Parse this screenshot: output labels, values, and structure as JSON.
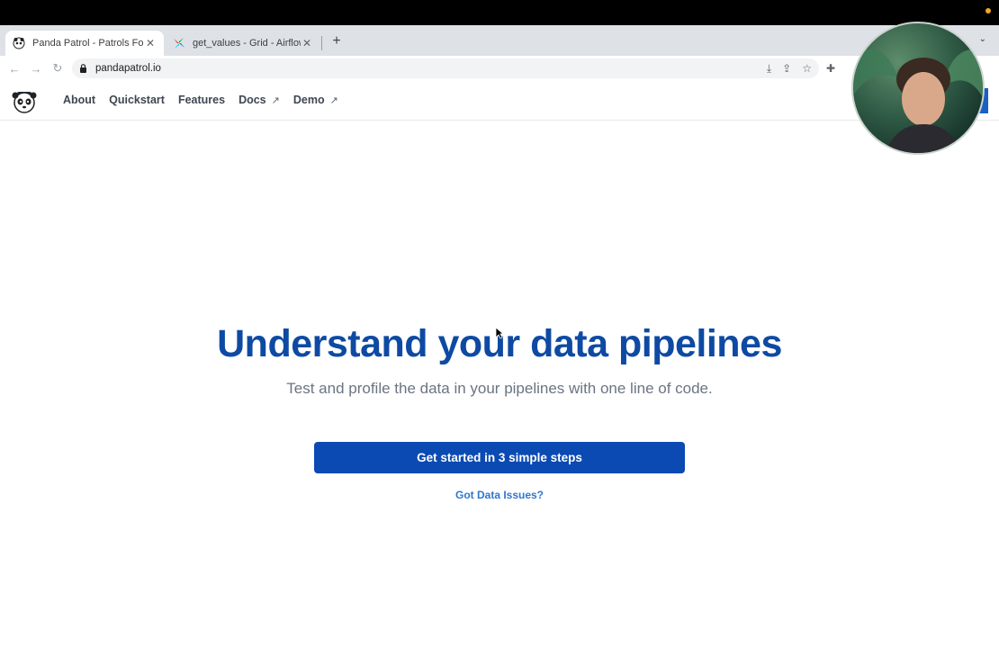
{
  "browser": {
    "tabs": [
      {
        "title": "Panda Patrol - Patrols For Dat",
        "active": true
      },
      {
        "title": "get_values - Grid - Airflow",
        "active": false
      }
    ],
    "address": "pandapatrol.io"
  },
  "site": {
    "nav": [
      "About",
      "Quickstart",
      "Features",
      "Docs",
      "Demo"
    ]
  },
  "hero": {
    "title": "Understand your data pipelines",
    "subtitle": "Test and profile the data in your pipelines with one line of code.",
    "cta": "Get started in 3 simple steps",
    "link": "Got Data Issues?"
  },
  "colors": {
    "title": "#0e4aa3",
    "cta": "#0b4ab3",
    "link": "#2f76cf"
  }
}
